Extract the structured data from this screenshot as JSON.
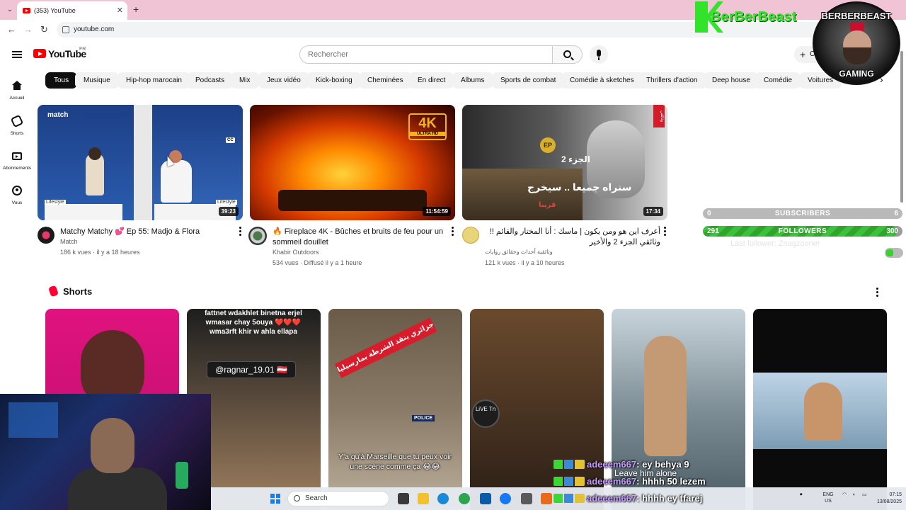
{
  "browser": {
    "tab_title": "(353) YouTube",
    "tab_close": "✕",
    "new_tab": "+",
    "tab_list": "⌄",
    "back": "←",
    "forward": "→",
    "reload": "↻",
    "url": "youtube.com"
  },
  "masthead": {
    "logo_text": "YouTube",
    "region": "FR",
    "search_placeholder": "Rechercher",
    "create_label": "Créer"
  },
  "sidebar": {
    "items": [
      {
        "label": "Accueil",
        "icon": "home-icon"
      },
      {
        "label": "Shorts",
        "icon": "shorts-icon"
      },
      {
        "label": "Abonnements",
        "icon": "subscriptions-icon"
      },
      {
        "label": "Vous",
        "icon": "you-icon"
      }
    ]
  },
  "chips": [
    "Tous",
    "Musique",
    "Hip-hop marocain",
    "Podcasts",
    "Mix",
    "Jeux vidéo",
    "Kick-boxing",
    "Cheminées",
    "En direct",
    "Albums",
    "Sports de combat",
    "Comédie à sketches",
    "Thrillers d'action",
    "Deep house",
    "Comédie",
    "Voitures"
  ],
  "chip_next": "›",
  "videos": [
    {
      "title": "Matchy Matchy 💕 Ep 55: Madjo & Flora",
      "channel": "Match",
      "meta": "186 k vues · il y a 18 heures",
      "duration": "39:23",
      "thumb_labels": {
        "brand": "match",
        "lifestyle_left": "Lifestyle",
        "lifestyle_right": "Lifestyle",
        "cc": "CC"
      }
    },
    {
      "title": "🔥 Fireplace 4K - Bûches et bruits de feu pour un sommeil douillet",
      "channel": "Khabir Outdoors",
      "meta": "534 vues · Diffusé il y a 1 heure",
      "duration": "11:54:59",
      "thumb_labels": {
        "badge_big": "4K",
        "badge_small": "ULTRA HD"
      }
    },
    {
      "title": "أعرف اين هو ومن يكون | ماسك : أنا المختار والقائم !! وثائقي الجزء 2 والأخير",
      "channel": "وثائقية أحداث وحقائق روايات",
      "meta": "121 k vues · il y a 10 heures",
      "duration": "17:34",
      "thumb_labels": {
        "logo": "EP",
        "ar_main": "سنراه جميعا .. سيخرج",
        "ar_sub": "قريبا",
        "part": "الجزء 2",
        "side_tag": "وثائقي"
      }
    }
  ],
  "shorts": {
    "heading": "Shorts",
    "items": [
      {
        "overlay": ""
      },
      {
        "overlay": "fattnet wdakhlet binetna erjel wmasar chay 5ouya ❤️❤️❤️ wma3rft khir w ahla ellapa",
        "handle": "@ragnar_19.01 🇦🇹"
      },
      {
        "overlay": "Y'a qu'à Marseille que tu peux voir une scène comme ça 😂😂",
        "tag": "جزائري ينقذ الشرطة بمارسيليا",
        "badge": "POLICE"
      },
      {
        "overlay": "",
        "live_badge": "LiVE Tn"
      },
      {
        "overlay": ""
      },
      {
        "overlay": ""
      }
    ]
  },
  "overlay": {
    "brand": "BerBerBeast",
    "badge_top": "BERBERBEAST",
    "badge_bottom": "GAMING",
    "subscribers": {
      "label": "SUBSCRIBERS",
      "current": "0",
      "goal": "6",
      "progress": 0.0
    },
    "followers": {
      "label": "FOLLOWERS",
      "current": "291",
      "goal": "300",
      "progress": 0.97
    },
    "ghost_text": "Last follower: Znagzooner",
    "chat": [
      {
        "user": "adeeem667",
        "text": ": ey behya 9"
      },
      {
        "user": "adeeem667",
        "text": ": hhhh 50 lezem"
      },
      {
        "user": "adeeem667",
        "text": ": hhhh ey tfarej"
      }
    ],
    "chat_ghost": "Leave him alone"
  },
  "taskbar": {
    "search_label": "Search",
    "lang_top": "ENG",
    "lang_bottom": "US",
    "time": "07:15",
    "date": "13/08/2025"
  }
}
